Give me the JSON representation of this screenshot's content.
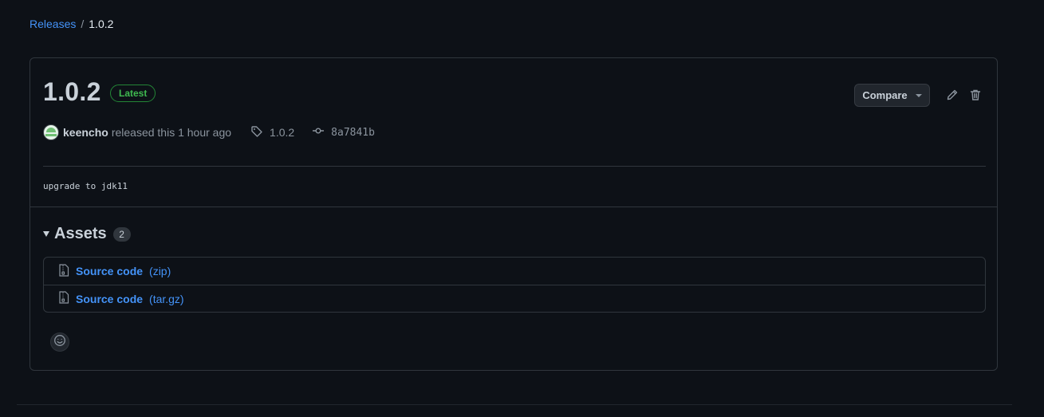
{
  "breadcrumb": {
    "parent": "Releases",
    "separator": "/",
    "current": "1.0.2"
  },
  "release": {
    "title": "1.0.2",
    "badge": "Latest",
    "author": "keencho",
    "released_text": "released this 1 hour ago",
    "tag": "1.0.2",
    "commit": "8a7841b",
    "notes": "upgrade to jdk11"
  },
  "toolbar": {
    "compare_label": "Compare",
    "edit_icon": "pencil-icon",
    "delete_icon": "trash-icon"
  },
  "assets": {
    "title": "Assets",
    "count": "2",
    "items": [
      {
        "name": "Source code",
        "ext": "(zip)",
        "icon": "file-zip-icon"
      },
      {
        "name": "Source code",
        "ext": "(tar.gz)",
        "icon": "file-zip-icon"
      }
    ]
  },
  "reactions": {
    "icon": "smiley-icon"
  },
  "colors": {
    "background": "#0d1117",
    "border": "#30363d",
    "link": "#4493f8",
    "latest_green": "#3fb950"
  }
}
